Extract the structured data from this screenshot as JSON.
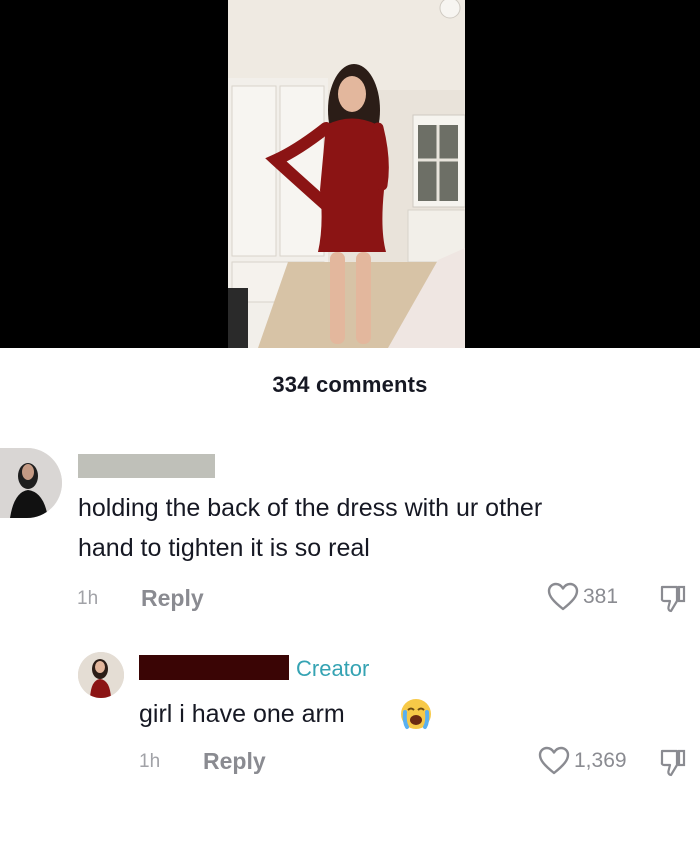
{
  "video": {
    "comments_count": "334 comments"
  },
  "comments": [
    {
      "text": "holding the back of the dress with ur other hand to tighten it is so real",
      "text_line1": "holding the back of the dress with ur other",
      "text_line2": "hand to tighten it is so real",
      "time": "1h",
      "reply_label": "Reply",
      "likes": "381",
      "icons": {
        "like": "heart-outline-icon",
        "dislike": "thumbs-down-icon"
      }
    },
    {
      "badge": "Creator",
      "text": "girl i have one arm",
      "time": "1h",
      "reply_label": "Reply",
      "likes": "1,369",
      "icons": {
        "emoji": "loudly-crying-face-icon",
        "like": "heart-outline-icon",
        "dislike": "thumbs-down-icon"
      }
    }
  ],
  "colors": {
    "background": "#ffffff",
    "text": "#161823",
    "muted": "#8a8b91",
    "creator_badge": "#35a3b3",
    "redaction_gray": "#bfc0b9",
    "redaction_dark": "#3a0505",
    "video_letterbox": "#000000"
  }
}
